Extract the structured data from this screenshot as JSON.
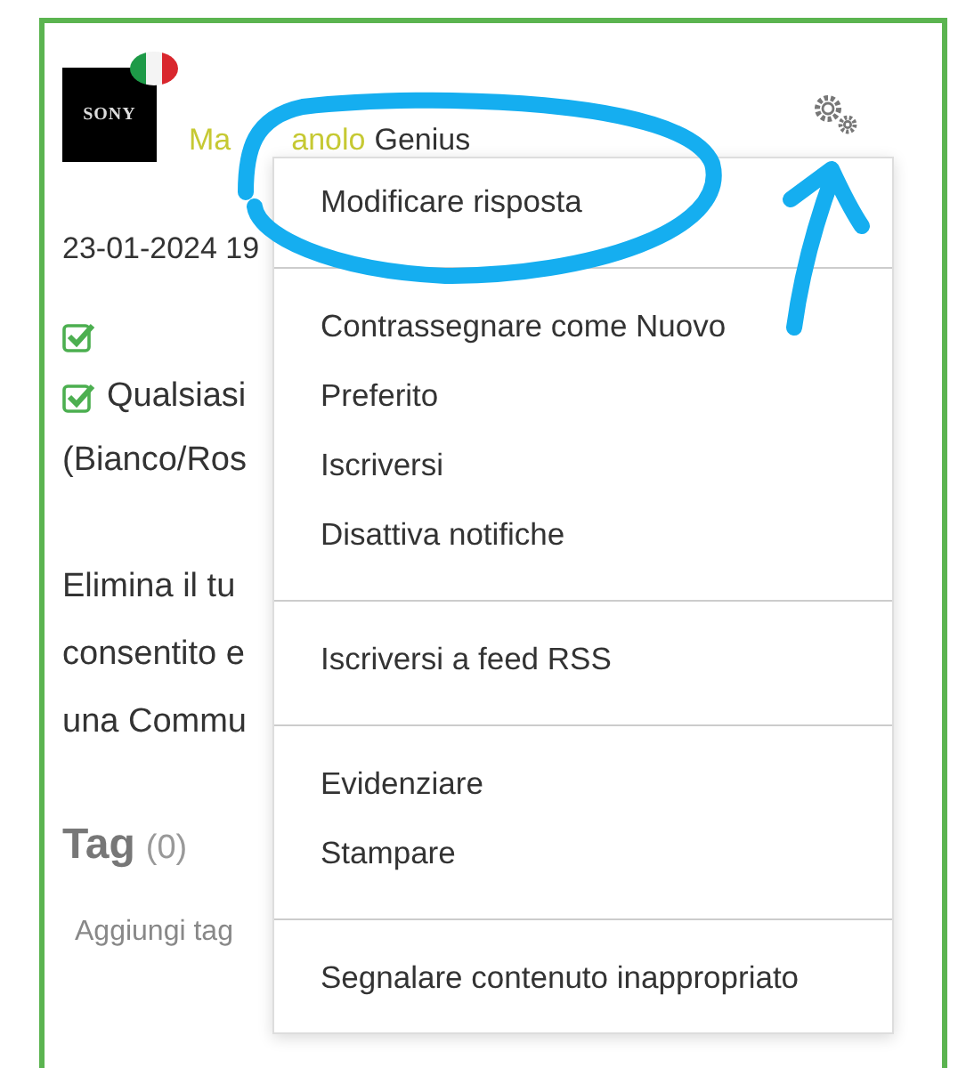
{
  "post": {
    "avatar": {
      "text": "SONY"
    },
    "author": {
      "visible_parts": [
        "Ma",
        "anolo"
      ],
      "rank": "Genius"
    },
    "date": "23-01-2024 19",
    "body": [
      {
        "kind": "check"
      },
      {
        "kind": "check",
        "text": "Qualsiasi"
      },
      {
        "kind": "text",
        "text": "(Bianco/Ros"
      },
      {
        "kind": "gap"
      },
      {
        "kind": "text",
        "text": "Elimina il tu"
      },
      {
        "kind": "text",
        "text": "consentito e"
      },
      {
        "kind": "text",
        "text": "una Commu"
      }
    ],
    "tags": {
      "title": "Tag",
      "count": "(0)",
      "add": "Aggiungi tag"
    }
  },
  "menu": {
    "groups": [
      [
        "Modificare risposta"
      ],
      [
        "Contrassegnare come Nuovo",
        "Preferito",
        "Iscriversi",
        "Disattiva notifiche"
      ],
      [
        "Iscriversi a feed RSS"
      ],
      [
        "Evidenziare",
        "Stampare"
      ],
      [
        "Segnalare contenuto inappropriato"
      ]
    ]
  }
}
